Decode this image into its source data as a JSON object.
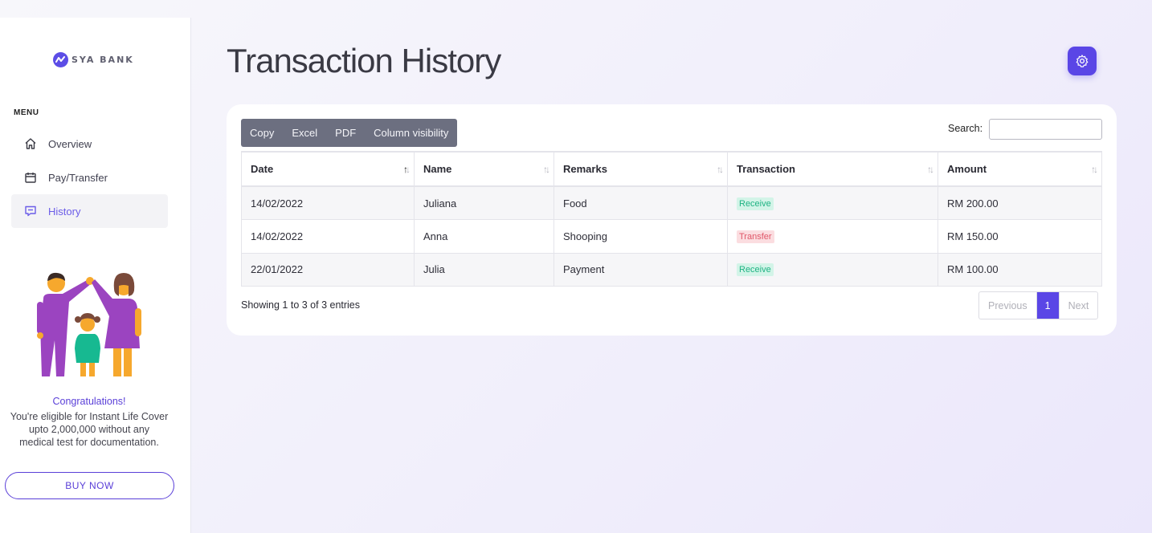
{
  "brand": {
    "name": "SYA BANK",
    "logo_icon": "wave-logo-icon",
    "accent": "#5a46e6"
  },
  "sidebar": {
    "menu_heading": "MENU",
    "items": [
      {
        "label": "Overview",
        "icon": "home-icon",
        "active": false
      },
      {
        "label": "Pay/Transfer",
        "icon": "calendar-icon",
        "active": false
      },
      {
        "label": "History",
        "icon": "message-icon",
        "active": true
      }
    ],
    "promo": {
      "title": "Congratulations!",
      "text_lines": [
        "You're eligible for Instant Life Cover",
        "upto 2,000,000 without any",
        "medical test for documentation."
      ],
      "button_label": "BUY NOW"
    }
  },
  "header": {
    "title": "Transaction History",
    "settings_icon": "gear-icon"
  },
  "table_tools": {
    "buttons": [
      "Copy",
      "Excel",
      "PDF",
      "Column visibility"
    ],
    "search_label": "Search:",
    "search_value": ""
  },
  "table": {
    "columns": [
      "Date",
      "Name",
      "Remarks",
      "Transaction",
      "Amount"
    ],
    "sorted_column": "Date",
    "sort_direction": "ascending",
    "rows": [
      {
        "date": "14/02/2022",
        "name": "Juliana",
        "remarks": "Food",
        "transaction": "Receive",
        "amount": "RM 200.00"
      },
      {
        "date": "14/02/2022",
        "name": "Anna",
        "remarks": "Shooping",
        "transaction": "Transfer",
        "amount": "RM 150.00"
      },
      {
        "date": "22/01/2022",
        "name": "Julia",
        "remarks": "Payment",
        "transaction": "Receive",
        "amount": "RM 100.00"
      }
    ],
    "status_colors": {
      "Receive": "#1fb383",
      "Transfer": "#e0586a"
    }
  },
  "footer": {
    "info": "Showing 1 to 3 of 3 entries",
    "pager": {
      "previous": "Previous",
      "current": "1",
      "next": "Next"
    }
  }
}
